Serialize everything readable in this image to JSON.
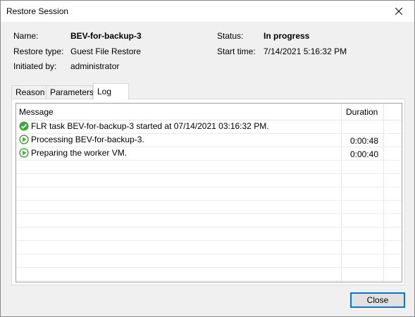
{
  "window": {
    "title": "Restore Session",
    "close_icon": "close-icon"
  },
  "info": {
    "name_label": "Name:",
    "name_value": "BEV-for-backup-3",
    "restore_type_label": "Restore type:",
    "restore_type_value": "Guest File Restore",
    "initiated_by_label": "Initiated by:",
    "initiated_by_value": "administrator",
    "status_label": "Status:",
    "status_value": "In progress",
    "start_time_label": "Start time:",
    "start_time_value": "7/14/2021 5:16:32 PM"
  },
  "tabs": [
    {
      "label": "Reason"
    },
    {
      "label": "Parameters"
    },
    {
      "label": "Log",
      "active": true
    }
  ],
  "log": {
    "columns": {
      "message": "Message",
      "duration": "Duration"
    },
    "rows": [
      {
        "icon": "success-check-icon",
        "message": "FLR task BEV-for-backup-3 started at 07/14/2021 03:16:32 PM.",
        "duration": ""
      },
      {
        "icon": "running-play-icon",
        "message": "Processing BEV-for-backup-3.",
        "duration": "0:00:48"
      },
      {
        "icon": "running-play-icon",
        "message": "Preparing the worker VM.",
        "duration": "0:00:40"
      }
    ]
  },
  "footer": {
    "close_label": "Close"
  },
  "colors": {
    "success": "#3fa535",
    "accent": "#0078d7"
  }
}
